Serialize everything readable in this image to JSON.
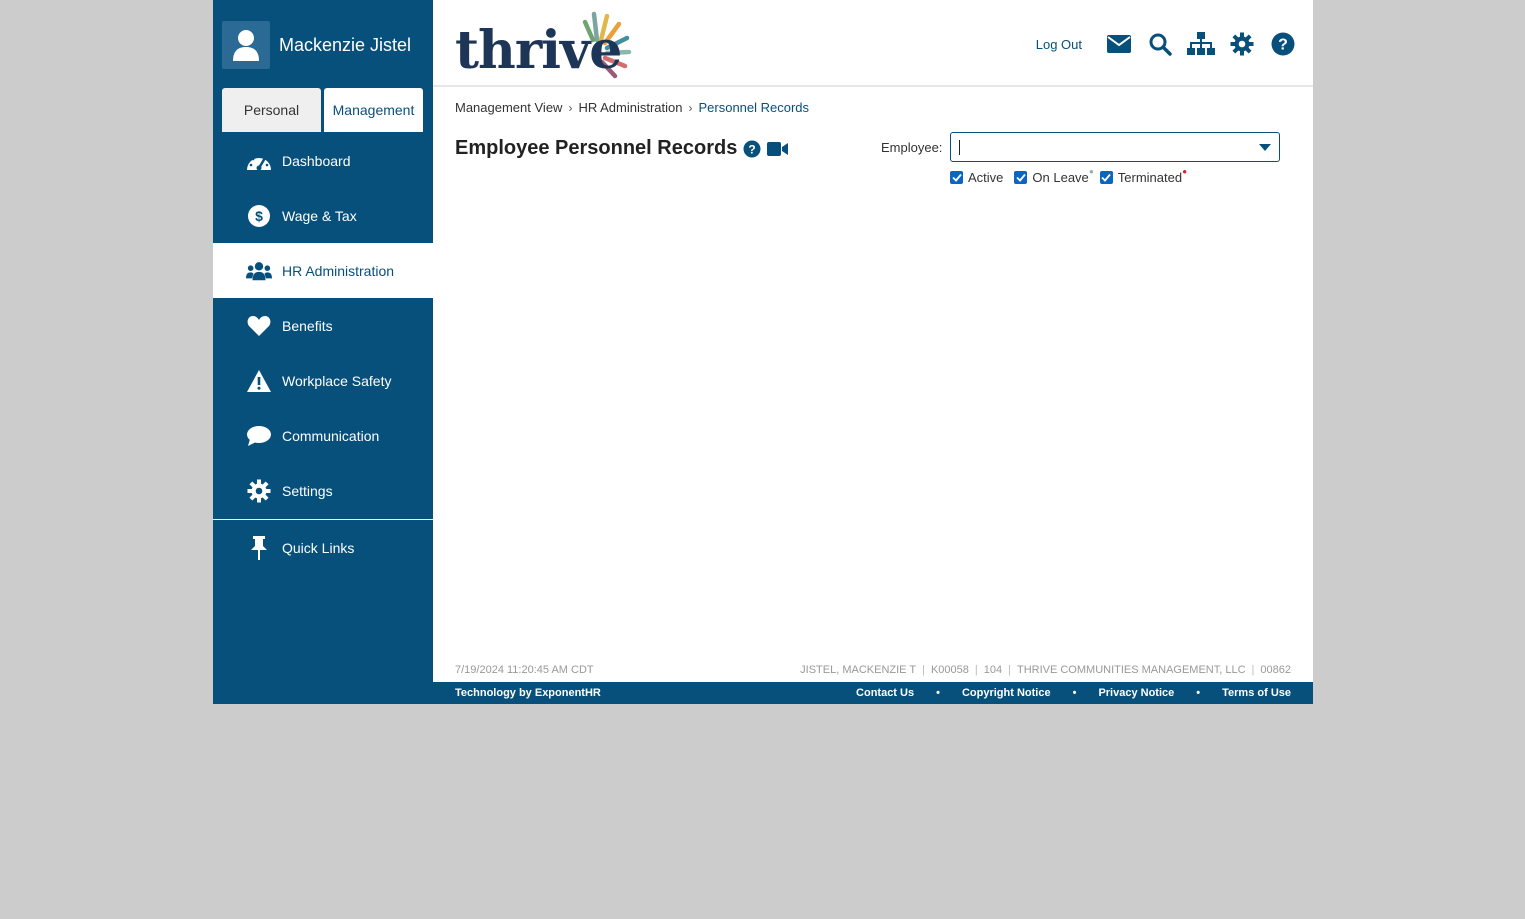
{
  "user": {
    "name": "Mackenzie Jistel"
  },
  "tabs": {
    "personal": "Personal",
    "management": "Management"
  },
  "nav": {
    "items": [
      {
        "label": "Dashboard",
        "icon": "dashboard-gauge-icon"
      },
      {
        "label": "Wage & Tax",
        "icon": "dollar-circle-icon"
      },
      {
        "label": "HR Administration",
        "icon": "users-icon",
        "active": true
      },
      {
        "label": "Benefits",
        "icon": "heart-icon"
      },
      {
        "label": "Workplace Safety",
        "icon": "warning-triangle-icon"
      },
      {
        "label": "Communication",
        "icon": "chat-bubble-icon"
      },
      {
        "label": "Settings",
        "icon": "gear-icon"
      }
    ],
    "quick_links": "Quick Links"
  },
  "header": {
    "logo_text": "thrive",
    "logout": "Log Out",
    "icons": [
      "mail-icon",
      "search-icon",
      "org-chart-icon",
      "gear-icon",
      "help-icon"
    ]
  },
  "breadcrumb": {
    "items": [
      "Management View",
      "HR Administration",
      "Personnel Records"
    ]
  },
  "page": {
    "title": "Employee Personnel Records",
    "employee_label": "Employee:",
    "employee_value": "",
    "filters": {
      "active": "Active",
      "on_leave": "On Leave",
      "terminated": "Terminated"
    }
  },
  "status": {
    "timestamp": "7/19/2024 11:20:45 AM CDT",
    "user_code": "JISTEL, MACKENZIE T",
    "employee_id": "K00058",
    "number": "104",
    "company": "THRIVE COMMUNITIES MANAGEMENT, LLC",
    "company_code": "00862"
  },
  "footer": {
    "tech": "Technology by ExponentHR",
    "links": [
      "Contact Us",
      "Copyright Notice",
      "Privacy Notice",
      "Terms of Use"
    ]
  },
  "colors": {
    "brand": "#07507c",
    "background": "#cccccc",
    "checkbox": "#0a66c2",
    "on_leave_dot": "#9aa",
    "terminated_dot": "#e02020"
  }
}
